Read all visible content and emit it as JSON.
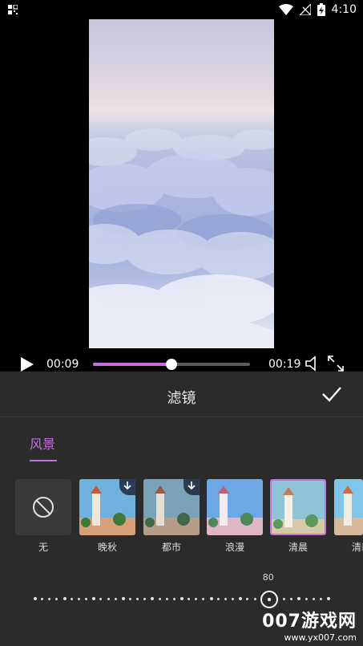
{
  "status_bar": {
    "time": "4:10"
  },
  "player": {
    "current_time": "00:09",
    "total_time": "00:19",
    "progress": 0.5
  },
  "filter_panel": {
    "title": "滤镜",
    "tab": "风景",
    "filters": [
      {
        "label": "无",
        "type": "none"
      },
      {
        "label": "晚秋",
        "download": true,
        "tint": "#6fb2dd"
      },
      {
        "label": "都市",
        "download": true,
        "tint": "#7aa3b8"
      },
      {
        "label": "浪漫",
        "download": false,
        "tint": "#6ea7e6"
      },
      {
        "label": "清晨",
        "download": false,
        "tint": "#8fc4d8",
        "selected": true
      },
      {
        "label": "清新",
        "download": false,
        "tint": "#7fc6e8"
      }
    ],
    "intensity": 80
  },
  "watermark": {
    "big": "007游戏网",
    "small": "www.yx007.com"
  },
  "accent_color": "#c570e0"
}
